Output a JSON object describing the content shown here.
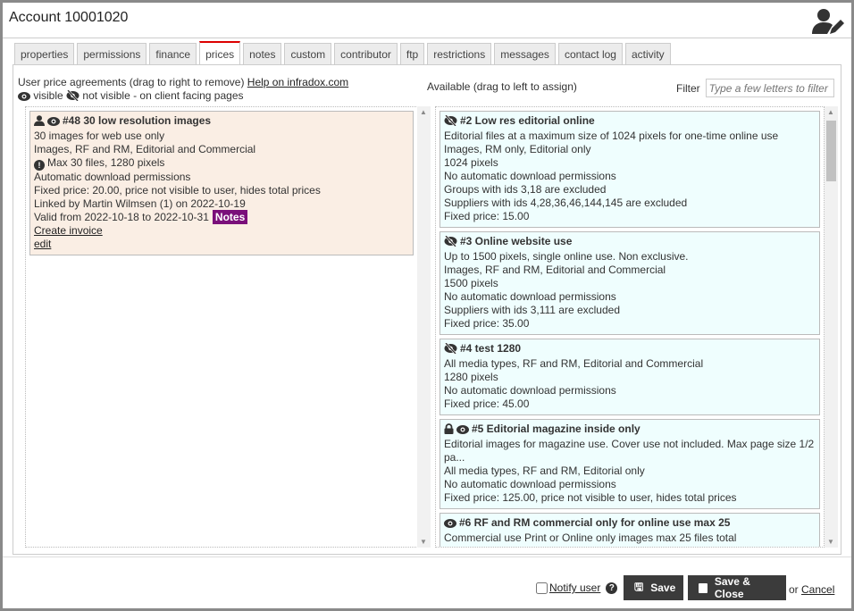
{
  "window": {
    "title": "Account 10001020",
    "user_icon": "user-edit-icon"
  },
  "tabs": [
    {
      "label": "properties"
    },
    {
      "label": "permissions"
    },
    {
      "label": "finance"
    },
    {
      "label": "prices",
      "active": true
    },
    {
      "label": "notes"
    },
    {
      "label": "custom"
    },
    {
      "label": "contributor"
    },
    {
      "label": "ftp"
    },
    {
      "label": "restrictions"
    },
    {
      "label": "messages"
    },
    {
      "label": "contact log"
    },
    {
      "label": "activity"
    }
  ],
  "left": {
    "heading": "User price agreements (drag to right to remove)",
    "help_link": "Help on infradox.com",
    "legend_visible": "visible",
    "legend_not_visible": "not visible - on client facing pages"
  },
  "right": {
    "heading": "Available (drag to left to assign)",
    "filter_label": "Filter",
    "filter_placeholder": "Type a few letters to filter"
  },
  "assigned": [
    {
      "icons": [
        "user",
        "eye"
      ],
      "title": "#48 30 low resolution images",
      "lines": [
        "30 images for web use only",
        "Images, RF and RM, Editorial and Commercial"
      ],
      "warning": "Max 30 files, 1280 pixels",
      "lines2": [
        "Automatic download permissions",
        "Fixed price: 20.00, price not visible to user, hides total prices",
        "Linked by Martin Wilmsen (1) on 2022-10-19"
      ],
      "valid": "Valid from 2022-10-18 to 2022-10-31",
      "notes_badge": "Notes",
      "links": [
        "Create invoice",
        "edit"
      ]
    }
  ],
  "available": [
    {
      "icons": [
        "eye-slash"
      ],
      "title": "#2 Low res editorial online",
      "lines": [
        "Editorial files at a maximum size of 1024 pixels for one-time online use",
        "Images, RM only, Editorial only",
        "1024 pixels",
        "No automatic download permissions",
        "Groups with ids 3,18 are excluded",
        "Suppliers with ids 4,28,36,46,144,145 are excluded",
        "Fixed price: 15.00"
      ]
    },
    {
      "icons": [
        "eye-slash"
      ],
      "title": "#3 Online website use",
      "lines": [
        "Up to 1500 pixels, single online use. Non exclusive.",
        "Images, RF and RM, Editorial and Commercial",
        "1500 pixels",
        "No automatic download permissions",
        "Suppliers with ids 3,111 are excluded",
        "Fixed price: 35.00"
      ]
    },
    {
      "icons": [
        "eye-slash"
      ],
      "title": "#4 test 1280",
      "lines": [
        "All media types, RF and RM, Editorial and Commercial",
        "1280 pixels",
        "No automatic download permissions",
        "Fixed price: 45.00"
      ]
    },
    {
      "icons": [
        "lock",
        "eye"
      ],
      "title": "#5 Editorial magazine inside only",
      "lines": [
        "Editorial images for magazine use. Cover use not included. Max page size 1/2 pa...",
        "All media types, RF and RM, Editorial only",
        "No automatic download permissions",
        "Fixed price: 125.00, price not visible to user, hides total prices"
      ]
    },
    {
      "icons": [
        "eye"
      ],
      "title": "#6 RF and RM commercial only for online use max 25",
      "lines": [
        "Commercial use Print or Online only images max 25 files total"
      ]
    }
  ],
  "footer": {
    "notify_label": "Notify user",
    "save": "Save",
    "save_close": "Save & Close",
    "or": "or",
    "cancel": "Cancel"
  },
  "colors": {
    "assigned_bg": "#faeee4",
    "available_bg": "#effefe",
    "notes_badge": "#7a0f7a",
    "button": "#3b3b3b",
    "active_tab": "#dd0000"
  }
}
